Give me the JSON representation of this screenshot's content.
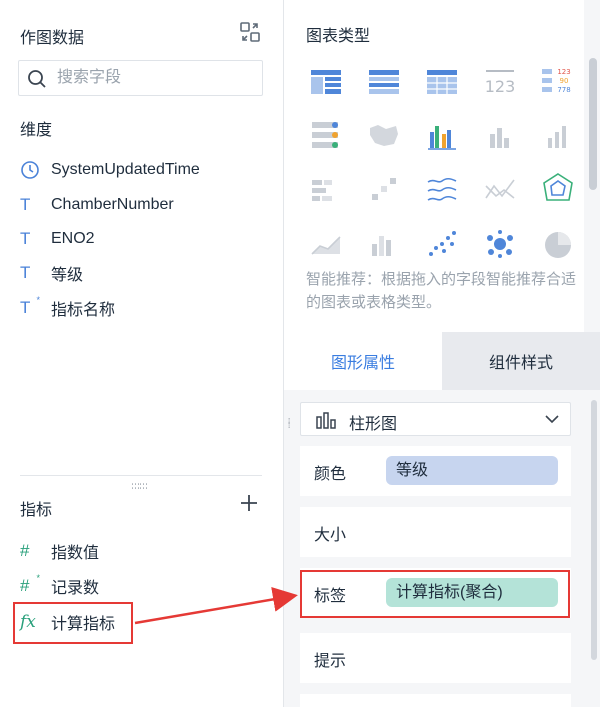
{
  "left_panel": {
    "title": "作图数据",
    "search": {
      "placeholder": "搜索字段",
      "value": ""
    },
    "dimensions_label": "维度",
    "dimensions": [
      {
        "icon": "clock-icon",
        "icon_text": "",
        "label": "SystemUpdatedTime"
      },
      {
        "icon": "text-type-icon",
        "icon_text": "T",
        "label": "ChamberNumber"
      },
      {
        "icon": "text-type-icon",
        "icon_text": "T",
        "label": "ENO2"
      },
      {
        "icon": "text-type-icon",
        "icon_text": "T",
        "label": "等级"
      },
      {
        "icon": "calculated-text-icon",
        "icon_text": "T",
        "label": "指标名称"
      }
    ],
    "measures_label": "指标",
    "measures": [
      {
        "icon": "number-type-icon",
        "icon_text": "#",
        "label": "指数值"
      },
      {
        "icon": "calculated-number-icon",
        "icon_text": "#",
        "label": "记录数"
      },
      {
        "icon": "formula-icon",
        "icon_text": "fx",
        "label": "计算指标"
      }
    ]
  },
  "right_panel": {
    "chart_type_title": "图表类型",
    "hint": "智能推荐：根据拖入的字段智能推荐合适的图表或表格类型。",
    "tabs": {
      "active": "图形属性",
      "inactive": "组件样式"
    },
    "chart_select": {
      "value": "柱形图"
    },
    "properties": [
      {
        "label": "颜色",
        "pill": "等级",
        "pill_color": "#c7d5ef"
      },
      {
        "label": "大小",
        "pill": ""
      },
      {
        "label": "标签",
        "pill": "计算指标(聚合)",
        "pill_color": "#b4e3d8"
      },
      {
        "label": "提示",
        "pill": ""
      }
    ]
  },
  "colors": {
    "accent": "#3a7de0",
    "highlight": "#e53935",
    "field_icon_blue": "#4a82d8",
    "field_icon_green": "#29a07b"
  }
}
